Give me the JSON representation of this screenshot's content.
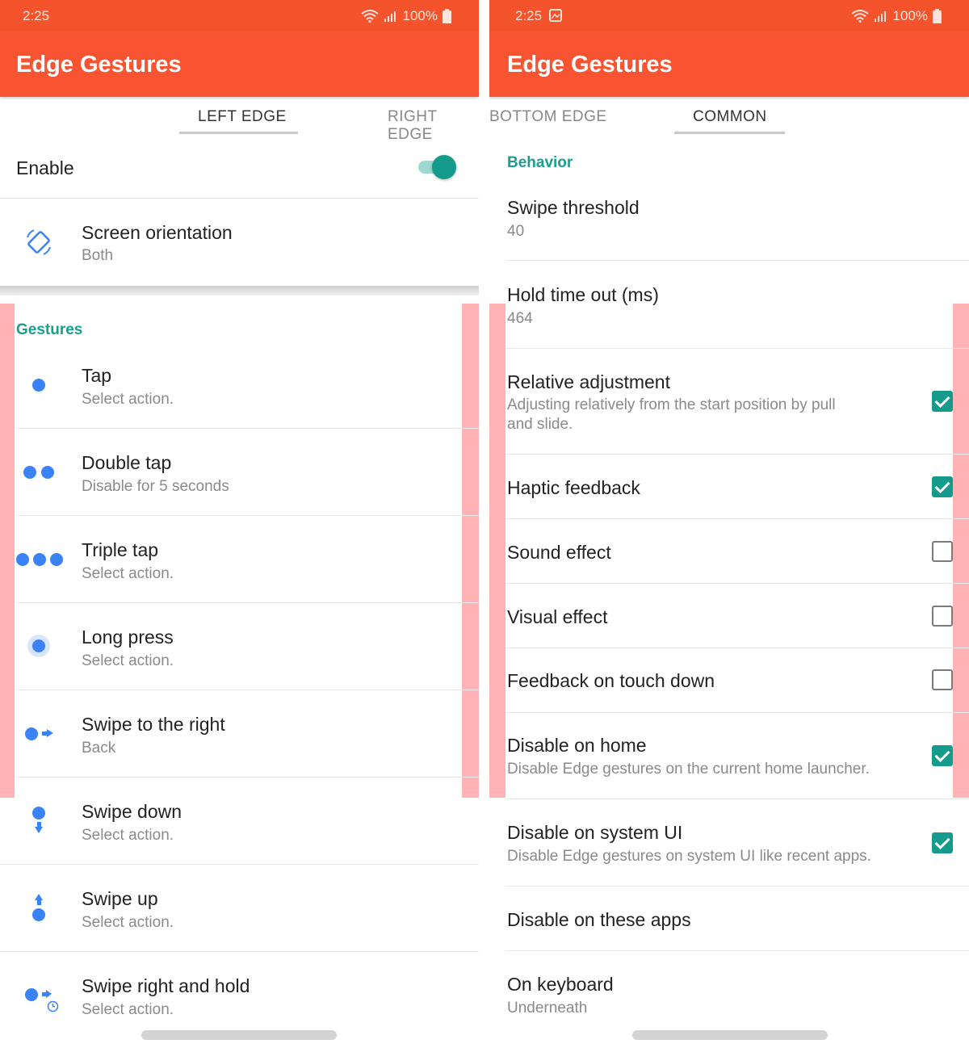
{
  "left": {
    "status": {
      "time": "2:25",
      "battery": "100%"
    },
    "title": "Edge Gestures",
    "tabs": [
      "LEFT EDGE",
      "RIGHT EDGE"
    ],
    "enable_label": "Enable",
    "enable_on": true,
    "orientation": {
      "title": "Screen orientation",
      "value": "Both",
      "icon": "screen-rotation-icon"
    },
    "gestures_header": "Gestures",
    "gestures": [
      {
        "title": "Tap",
        "subtitle": "Select action.",
        "icon": "tap-icon"
      },
      {
        "title": "Double tap",
        "subtitle": "Disable for 5 seconds",
        "icon": "double-tap-icon"
      },
      {
        "title": "Triple tap",
        "subtitle": "Select action.",
        "icon": "triple-tap-icon"
      },
      {
        "title": "Long press",
        "subtitle": "Select action.",
        "icon": "long-press-icon"
      },
      {
        "title": "Swipe to the right",
        "subtitle": "Back",
        "icon": "swipe-right-icon"
      },
      {
        "title": "Swipe down",
        "subtitle": "Select action.",
        "icon": "swipe-down-icon"
      },
      {
        "title": "Swipe up",
        "subtitle": "Select action.",
        "icon": "swipe-up-icon"
      },
      {
        "title": "Swipe right and hold",
        "subtitle": "Select action.",
        "icon": "swipe-right-hold-icon"
      }
    ]
  },
  "right": {
    "status": {
      "time": "2:25",
      "battery": "100%"
    },
    "title": "Edge Gestures",
    "tabs": [
      "BOTTOM EDGE",
      "COMMON"
    ],
    "behavior_header": "Behavior",
    "swipe_threshold": {
      "title": "Swipe threshold",
      "value": "40"
    },
    "hold_timeout": {
      "title": "Hold time out (ms)",
      "value": "464"
    },
    "options": [
      {
        "title": "Relative adjustment",
        "subtitle": "Adjusting relatively from the start position by pull",
        "subtitle2": "and slide.",
        "checked": true
      },
      {
        "title": "Haptic feedback",
        "subtitle": "",
        "checked": true
      },
      {
        "title": "Sound effect",
        "subtitle": "",
        "checked": false
      },
      {
        "title": "Visual effect",
        "subtitle": "",
        "checked": false
      },
      {
        "title": "Feedback on touch down",
        "subtitle": "",
        "checked": false
      },
      {
        "title": "Disable on home",
        "subtitle": "Disable Edge gestures on the current home launcher.",
        "checked": true
      },
      {
        "title": "Disable on system UI",
        "subtitle": "Disable Edge gestures on system UI like recent apps.",
        "checked": true
      }
    ],
    "disable_apps": "Disable on these apps",
    "keyboard": {
      "title": "On keyboard",
      "value": "Underneath"
    }
  },
  "colors": {
    "accent": "#f85431",
    "teal": "#149b8b",
    "gesture_blue": "#3a82f7",
    "edge_highlight": "#ffb3b5"
  }
}
